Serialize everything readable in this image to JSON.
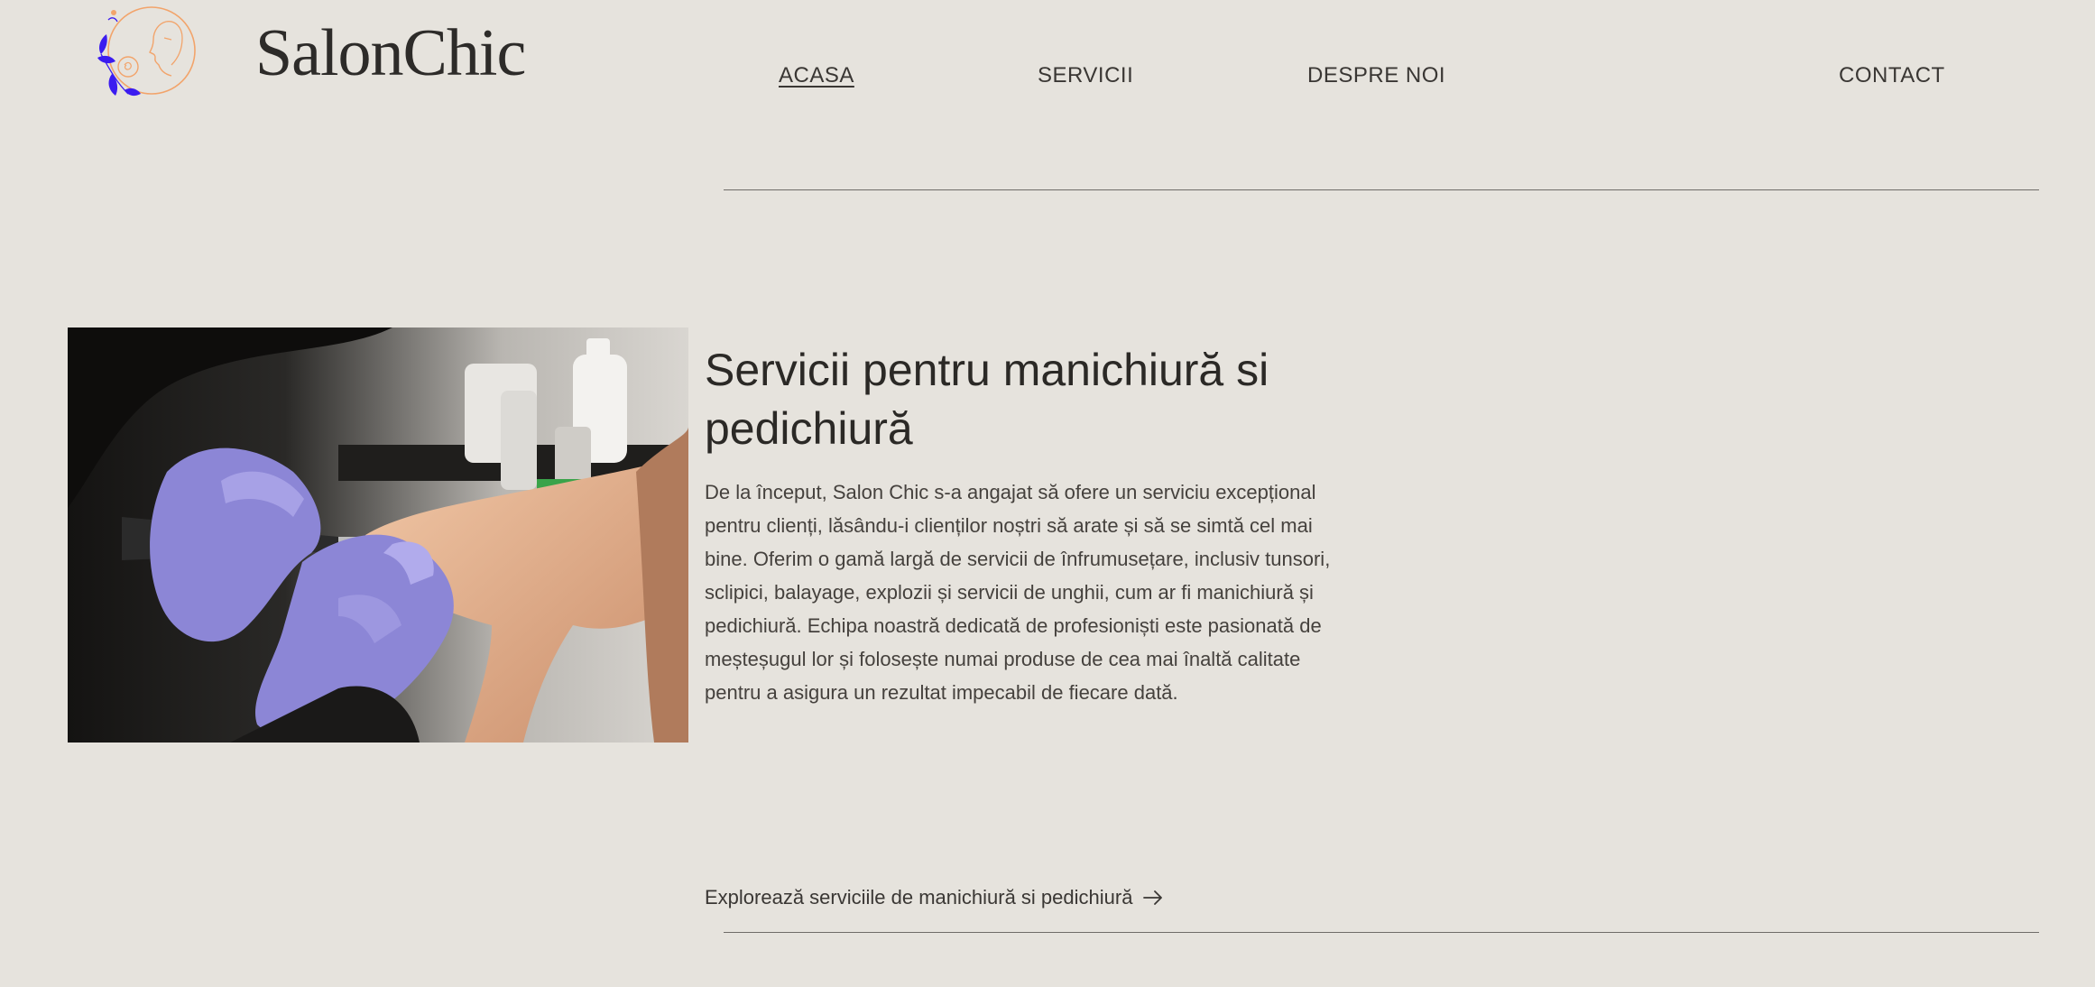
{
  "header": {
    "brand": "SalonChic",
    "nav": {
      "home": "ACASA",
      "services": "SERVICII",
      "about": "DESPRE NOI",
      "contact": "CONTACT"
    },
    "active": "home"
  },
  "hero": {
    "image_alt": "manicure-photo",
    "title_line1": "Servicii pentru manichiură si",
    "title_line2": "pedichiură",
    "body": "De la început, Salon Chic s-a angajat să ofere un serviciu excepțional pentru clienți, lăsându-i clienților noștri să arate și să se simtă cel mai bine. Oferim o gamă largă de servicii de înfrumusețare, inclusiv tunsori, sclipici, balayage, explozii și servicii de unghii, cum ar fi manichiură și pedichiură. Echipa noastră dedicată de profesioniști este pasionată de meșteșugul lor și folosește numai produse de cea mai înaltă calitate pentru a asigura un rezultat impecabil de fiecare dată.",
    "cta_label": "Explorează serviciile de manichiură si pedichiură",
    "cta_icon": "arrow-right-icon"
  },
  "colors": {
    "background": "#e6e3dd",
    "text": "#2f2d2a",
    "logo_orange": "#f2a46b",
    "logo_blue": "#3b1cf0",
    "glove": "#8c86d6"
  }
}
